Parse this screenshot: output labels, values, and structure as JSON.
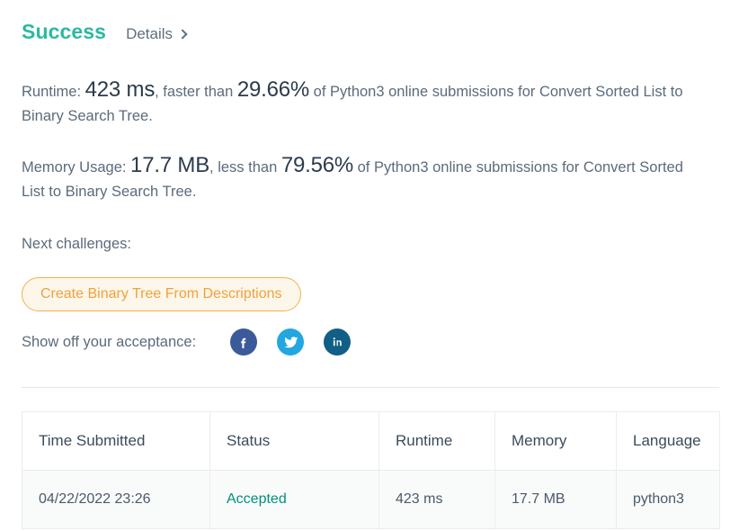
{
  "header": {
    "status": "Success",
    "details_label": "Details",
    "chevron_icon": "chevron-right-icon"
  },
  "runtime_stat": {
    "label": "Runtime:",
    "value": "423 ms",
    "comparator": ", faster than ",
    "percentile": "29.66%",
    "suffix": " of Python3 online submissions for Convert Sorted List to Binary Search Tree."
  },
  "memory_stat": {
    "label": "Memory Usage:",
    "value": "17.7 MB",
    "comparator": ", less than ",
    "percentile": "79.56%",
    "suffix": " of Python3 online submissions for Convert Sorted List to Binary Search Tree."
  },
  "next_challenges": {
    "label": "Next challenges:",
    "items": [
      {
        "label": "Create Binary Tree From Descriptions"
      }
    ]
  },
  "share": {
    "label": "Show off your acceptance:",
    "buttons": [
      {
        "name": "facebook-share-button",
        "icon": "facebook-icon",
        "color": "#3b5a9a"
      },
      {
        "name": "twitter-share-button",
        "icon": "twitter-icon",
        "color": "#22a7e0"
      },
      {
        "name": "linkedin-share-button",
        "icon": "linkedin-icon",
        "color": "#115f86"
      }
    ]
  },
  "submissions_table": {
    "columns": [
      "Time Submitted",
      "Status",
      "Runtime",
      "Memory",
      "Language"
    ],
    "rows": [
      {
        "time_submitted": "04/22/2022 23:26",
        "status": "Accepted",
        "runtime": "423 ms",
        "memory": "17.7 MB",
        "language": "python3"
      }
    ]
  },
  "colors": {
    "success_teal": "#2cb9a0",
    "accepted_teal": "#01907f",
    "pill_border": "#f3b14a",
    "pill_bg": "#fdf6ea",
    "pill_text": "#f0a13c",
    "body_text": "#5b6b7b",
    "strong_text": "#2b3b4b"
  }
}
